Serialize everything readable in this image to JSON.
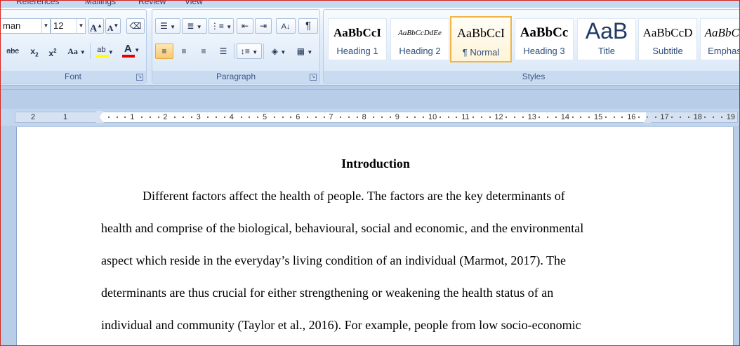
{
  "ribbon_tabs": [
    "References",
    "Mailings",
    "Review",
    "View"
  ],
  "font": {
    "group_label": "Font",
    "font_name": "man",
    "font_size": "12",
    "grow_label": "A",
    "shrink_label": "A",
    "strike_label": "abc",
    "subscript_label": "x",
    "subscript_mark": "2",
    "superscript_label": "x",
    "superscript_mark": "2",
    "case_label": "Aa",
    "highlight_label": "ab",
    "highlight_color": "#ffff00",
    "fontcolor_label": "A",
    "font_color": "#e60000"
  },
  "paragraph": {
    "group_label": "Paragraph",
    "pilcrow": "¶"
  },
  "styles": {
    "group_label": "Styles",
    "items": [
      {
        "sample": "AaBbCcI",
        "name": "Heading 1"
      },
      {
        "sample": "AaBbCcDdEe",
        "name": "Heading 2"
      },
      {
        "sample": "AaBbCcI",
        "name": "¶ Normal"
      },
      {
        "sample": "AaBbCc",
        "name": "Heading 3"
      },
      {
        "sample": "AaB",
        "name": "Title"
      },
      {
        "sample": "AaBbCcD",
        "name": "Subtitle"
      },
      {
        "sample": "AaBbCc",
        "name": "Emphas"
      }
    ]
  },
  "ruler": {
    "left_numbers": [
      "2",
      "1"
    ],
    "numbers": [
      "1",
      "2",
      "3",
      "4",
      "5",
      "6",
      "7",
      "8",
      "9",
      "10",
      "11",
      "12",
      "13",
      "14",
      "15",
      "16",
      "17",
      "18",
      "19"
    ]
  },
  "document": {
    "title": "Introduction",
    "lines": [
      "Different factors affect the health of people. The factors are the key determinants of",
      "health and comprise of the biological, behavioural, social and economic, and the environmental",
      "aspect which reside in the everyday’s living condition of an individual (Marmot, 2017).  The",
      "determinants are thus crucial for either strengthening or weakening the health status of an",
      "individual and community (Taylor et al., 2016). For example, people from low socio-economic"
    ]
  }
}
